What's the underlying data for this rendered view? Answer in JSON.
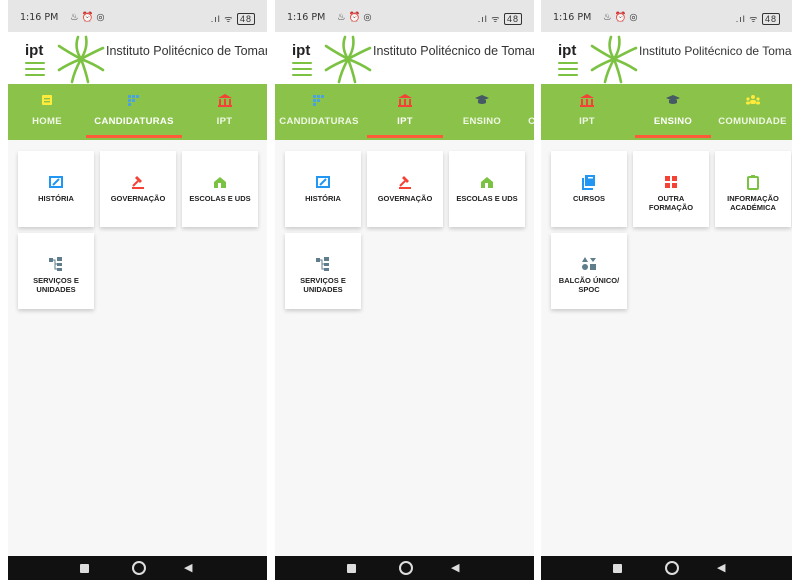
{
  "status": {
    "time": "1:16 PM",
    "extra_icons": "♨ ⏰ ◎",
    "signal": ".ıl ᯤ",
    "battery": "48"
  },
  "app": {
    "logo": "ipt",
    "institution": "Instituto Politécnico de Tomar"
  },
  "colors": {
    "accent_green": "#8bc34a",
    "underline": "#ff5b3a"
  },
  "screens": [
    {
      "tabs": [
        {
          "label": "HOME",
          "icon": "home-icon",
          "active": false
        },
        {
          "label": "CANDIDATURAS",
          "icon": "candidaturas-icon",
          "active": true
        },
        {
          "label": "IPT",
          "icon": "ipt-building-icon",
          "active": false
        }
      ],
      "cards": [
        {
          "label": "HISTÓRIA",
          "icon": "history-icon"
        },
        {
          "label": "GOVERNAÇÃO",
          "icon": "gavel-icon"
        },
        {
          "label": "ESCOLAS E UDS",
          "icon": "school-icon"
        },
        {
          "label": "SERVIÇOS E UNIDADES",
          "icon": "services-icon"
        }
      ]
    },
    {
      "tabs": [
        {
          "label": "CANDIDATURAS",
          "icon": "candidaturas-icon",
          "active": false
        },
        {
          "label": "IPT",
          "icon": "ipt-building-icon",
          "active": true
        },
        {
          "label": "ENSINO",
          "icon": "graduation-cap-icon",
          "active": false
        },
        {
          "label": "CS",
          "icon": "",
          "active": false
        }
      ],
      "cards": [
        {
          "label": "HISTÓRIA",
          "icon": "history-icon"
        },
        {
          "label": "GOVERNAÇÃO",
          "icon": "gavel-icon"
        },
        {
          "label": "ESCOLAS E UDS",
          "icon": "school-icon"
        },
        {
          "label": "SERVIÇOS E UNIDADES",
          "icon": "services-icon"
        }
      ]
    },
    {
      "tabs": [
        {
          "label": "IPT",
          "icon": "ipt-building-icon",
          "active": false
        },
        {
          "label": "ENSINO",
          "icon": "graduation-cap-icon",
          "active": true
        },
        {
          "label": "COMUNIDADE",
          "icon": "community-icon",
          "active": false
        }
      ],
      "cards": [
        {
          "label": "CURSOS",
          "icon": "book-icon"
        },
        {
          "label": "OUTRA FORMAÇÃO",
          "icon": "grid-icon"
        },
        {
          "label": "INFORMAÇÃO ACADÉMICA",
          "icon": "clipboard-icon"
        },
        {
          "label": "BALCÃO ÚNICO/ SPOC",
          "icon": "shapes-icon"
        }
      ]
    }
  ]
}
